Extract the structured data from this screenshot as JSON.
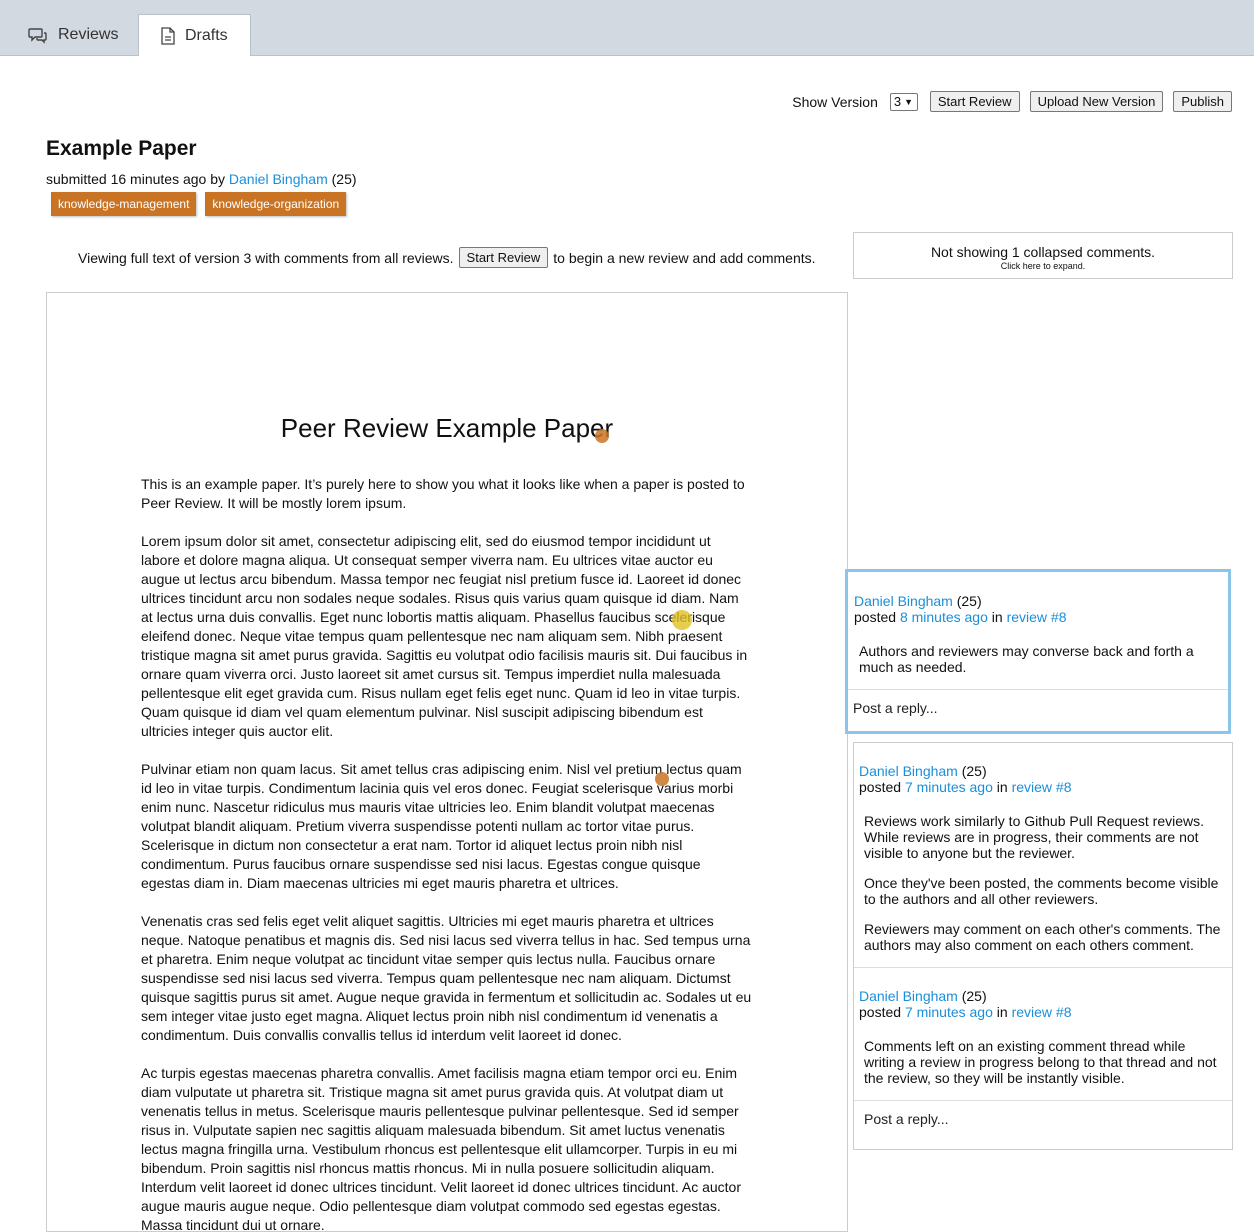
{
  "tabs": [
    {
      "label": "Reviews",
      "icon": "chat-bubbles-icon"
    },
    {
      "label": "Drafts",
      "icon": "document-icon"
    }
  ],
  "toolbar": {
    "show_version_label": "Show Version",
    "version_selected": "3",
    "start_review": "Start Review",
    "upload_new_version": "Upload New Version",
    "publish": "Publish"
  },
  "paper": {
    "title": "Example Paper",
    "submitted_prefix": "submitted 16 minutes ago by",
    "author": "Daniel Bingham",
    "author_rep": "(25)",
    "tags": [
      "knowledge-management",
      "knowledge-organization"
    ]
  },
  "viewing": {
    "before": "Viewing full text of version 3 with comments from all reviews.",
    "button": "Start Review",
    "after": "to begin a new review and add comments."
  },
  "collapsed": {
    "message": "Not showing 1 collapsed comments.",
    "hint": "Click here to expand."
  },
  "document": {
    "heading": "Peer Review Example Paper",
    "paragraphs": [
      "This is an example paper.  It’s purely here to show you what it looks like when a paper is posted to Peer Review.  It will be mostly lorem ipsum.",
      "Lorem ipsum dolor sit amet, consectetur adipiscing elit, sed do eiusmod tempor incididunt ut labore et dolore magna aliqua. Ut consequat semper viverra nam. Eu ultrices vitae auctor eu augue ut lectus arcu bibendum. Massa tempor nec feugiat nisl pretium fusce id. Laoreet id donec ultrices tincidunt arcu non sodales neque sodales. Risus quis varius quam quisque id diam. Nam at lectus urna duis convallis. Eget nunc lobortis mattis aliquam. Phasellus faucibus scelerisque eleifend donec. Neque vitae tempus quam pellentesque nec nam aliquam sem. Nibh praesent tristique magna sit amet purus gravida. Sagittis eu volutpat odio facilisis mauris sit. Dui faucibus in ornare quam viverra orci. Justo laoreet sit amet cursus sit. Tempus imperdiet nulla malesuada pellentesque elit eget gravida cum. Risus nullam eget felis eget nunc. Quam id leo in vitae turpis. Quam quisque id diam vel quam elementum pulvinar. Nisl suscipit adipiscing bibendum est ultricies integer quis auctor elit.",
      "Pulvinar etiam non quam lacus. Sit amet tellus cras adipiscing enim. Nisl vel pretium lectus quam id leo in vitae turpis. Condimentum lacinia quis vel eros donec. Feugiat scelerisque varius morbi enim nunc. Nascetur ridiculus mus mauris vitae ultricies leo. Enim blandit volutpat maecenas volutpat blandit aliquam. Pretium viverra suspendisse potenti nullam ac tortor vitae purus. Scelerisque in dictum non consectetur a erat nam. Tortor id aliquet lectus proin nibh nisl condimentum. Purus faucibus ornare suspendisse sed nisi lacus. Egestas congue quisque egestas diam in. Diam maecenas ultricies mi eget mauris pharetra et ultrices.",
      "Venenatis cras sed felis eget velit aliquet sagittis. Ultricies mi eget mauris pharetra et ultrices neque. Natoque penatibus et magnis dis. Sed nisi lacus sed viverra tellus in hac. Sed tempus urna et pharetra. Enim neque volutpat ac tincidunt vitae semper quis lectus nulla. Faucibus ornare suspendisse sed nisi lacus sed viverra. Tempus quam pellentesque nec nam aliquam. Dictumst quisque sagittis purus sit amet. Augue neque gravida in fermentum et sollicitudin ac. Sodales ut eu sem integer vitae justo eget magna. Aliquet lectus proin nibh nisl condimentum id venenatis a condimentum. Duis convallis convallis tellus id interdum velit laoreet id donec.",
      "Ac turpis egestas maecenas pharetra convallis. Amet facilisis magna etiam tempor orci eu. Enim diam vulputate ut pharetra sit. Tristique magna sit amet purus gravida quis. At volutpat diam ut venenatis tellus in metus. Scelerisque mauris pellentesque pulvinar pellentesque. Sed id semper risus in. Vulputate sapien nec sagittis aliquam malesuada bibendum. Sit amet luctus venenatis lectus magna fringilla urna. Vestibulum rhoncus est pellentesque elit ullamcorper. Turpis in eu mi bibendum. Proin sagittis nisl rhoncus mattis rhoncus. Mi in nulla posuere sollicitudin aliquam. Interdum velit laoreet id donec ultrices tincidunt. Velit laoreet id donec ultrices tincidunt. Ac auctor augue mauris augue neque. Odio pellentesque diam volutpat commodo sed egestas egestas. Massa tincidunt dui ut ornare."
    ],
    "marker_colors": {
      "orange": "#c97425",
      "yellow": "#e0c020"
    }
  },
  "threads": [
    {
      "comments": [
        {
          "author": "Daniel Bingham",
          "rep": "(25)",
          "posted": "posted",
          "time": "8 minutes ago",
          "in": "in",
          "review": "review #8",
          "paragraphs": [
            "Authors and reviewers may converse back and forth a much as needed."
          ]
        }
      ],
      "reply_placeholder": "Post a reply..."
    },
    {
      "comments": [
        {
          "author": "Daniel Bingham",
          "rep": "(25)",
          "posted": "posted",
          "time": "7 minutes ago",
          "in": "in",
          "review": "review #8",
          "paragraphs": [
            "Reviews work similarly to Github Pull Request reviews. While reviews are in progress, their comments are not visible to anyone but the reviewer.",
            "Once they've been posted, the comments become visible to the authors and all other reviewers.",
            "Reviewers may comment on each other's comments. The authors may also comment on each others comment."
          ]
        },
        {
          "author": "Daniel Bingham",
          "rep": "(25)",
          "posted": "posted",
          "time": "7 minutes ago",
          "in": "in",
          "review": "review #8",
          "paragraphs": [
            "Comments left on an existing comment thread while writing a review in progress belong to that thread and not the review, so they will be instantly visible."
          ]
        }
      ],
      "reply_placeholder": "Post a reply..."
    }
  ]
}
